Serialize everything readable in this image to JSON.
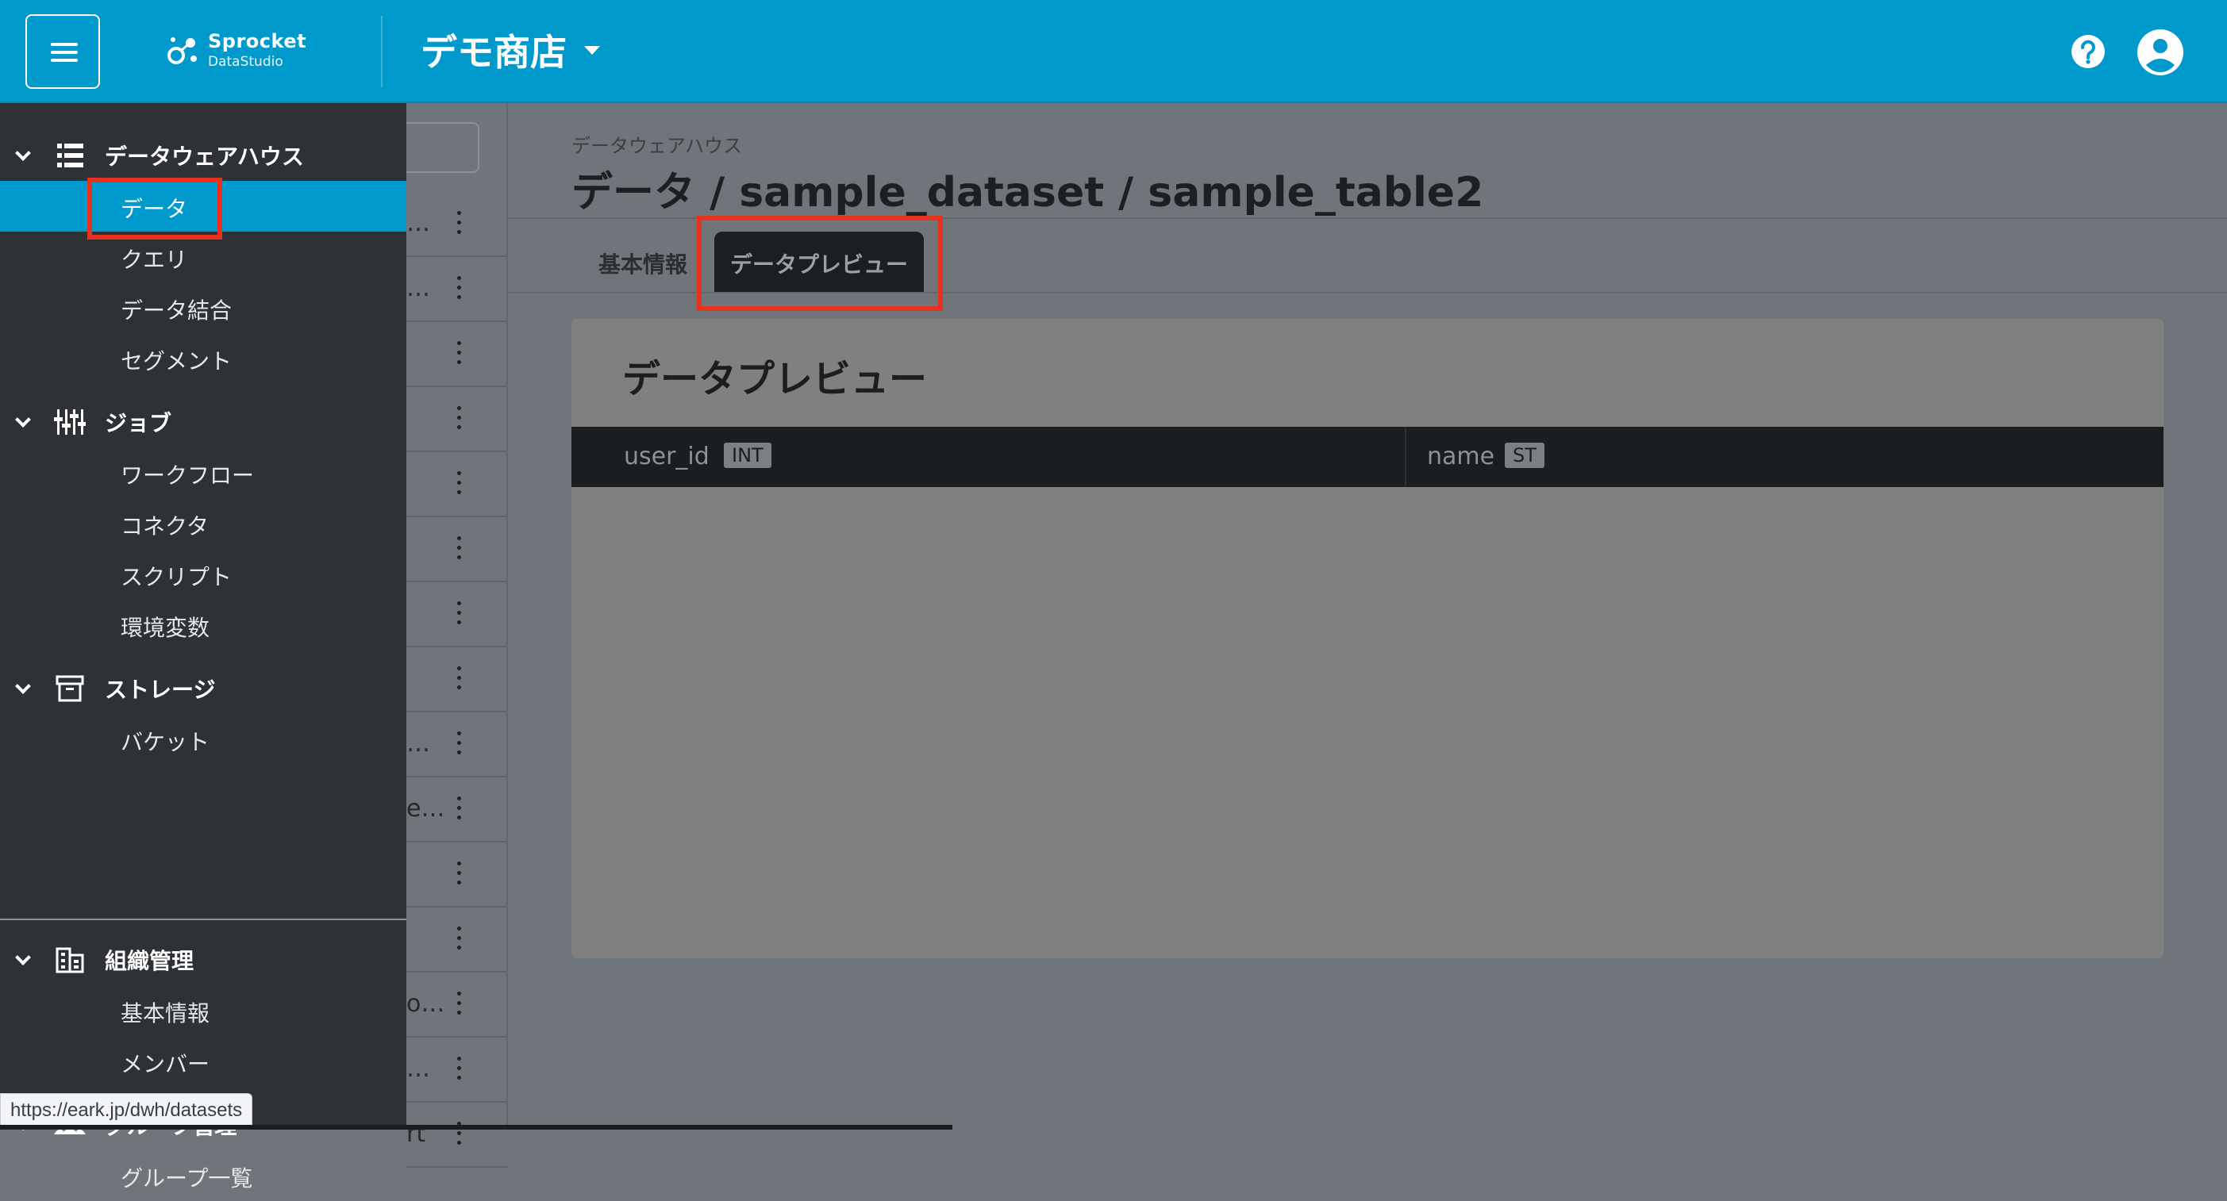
{
  "header": {
    "brand_name": "Sprocket",
    "brand_sub": "DataStudio",
    "store_name": "デモ商店",
    "colors": {
      "primary": "#0099cc",
      "sidebar": "#2e3236",
      "highlight": "#e8321e"
    }
  },
  "sidebar": {
    "sections": [
      {
        "label": "データウェアハウス",
        "icon": "database-icon",
        "items": [
          {
            "label": "データ",
            "active": true
          },
          {
            "label": "クエリ"
          },
          {
            "label": "データ結合"
          },
          {
            "label": "セグメント"
          }
        ]
      },
      {
        "label": "ジョブ",
        "icon": "sliders-icon",
        "items": [
          {
            "label": "ワークフロー"
          },
          {
            "label": "コネクタ"
          },
          {
            "label": "スクリプト"
          },
          {
            "label": "環境変数"
          }
        ]
      },
      {
        "label": "ストレージ",
        "icon": "archive-icon",
        "items": [
          {
            "label": "バケット"
          }
        ]
      },
      {
        "label": "組織管理",
        "icon": "building-icon",
        "items": [
          {
            "label": "基本情報"
          },
          {
            "label": "メンバー"
          }
        ]
      },
      {
        "label": "グループ管理",
        "icon": "group-icon",
        "items": [
          {
            "label": "グループ一覧"
          }
        ]
      }
    ]
  },
  "under_list": {
    "rows": [
      "…",
      "…",
      "",
      "",
      "",
      "",
      "",
      "",
      "…",
      "e…",
      "",
      "",
      "o…",
      "…",
      "rt"
    ]
  },
  "main": {
    "breadcrumb_small": "データウェアハウス",
    "title": "データ / sample_dataset / sample_table2",
    "tabs": [
      {
        "label": "基本情報"
      },
      {
        "label": "データプレビュー",
        "active": true
      }
    ],
    "card_title": "データプレビュー",
    "columns": [
      {
        "name": "user_id",
        "type": "INT"
      },
      {
        "name": "name",
        "type": "ST"
      }
    ]
  },
  "status_bar": {
    "url": "https://eark.jp/dwh/datasets"
  }
}
